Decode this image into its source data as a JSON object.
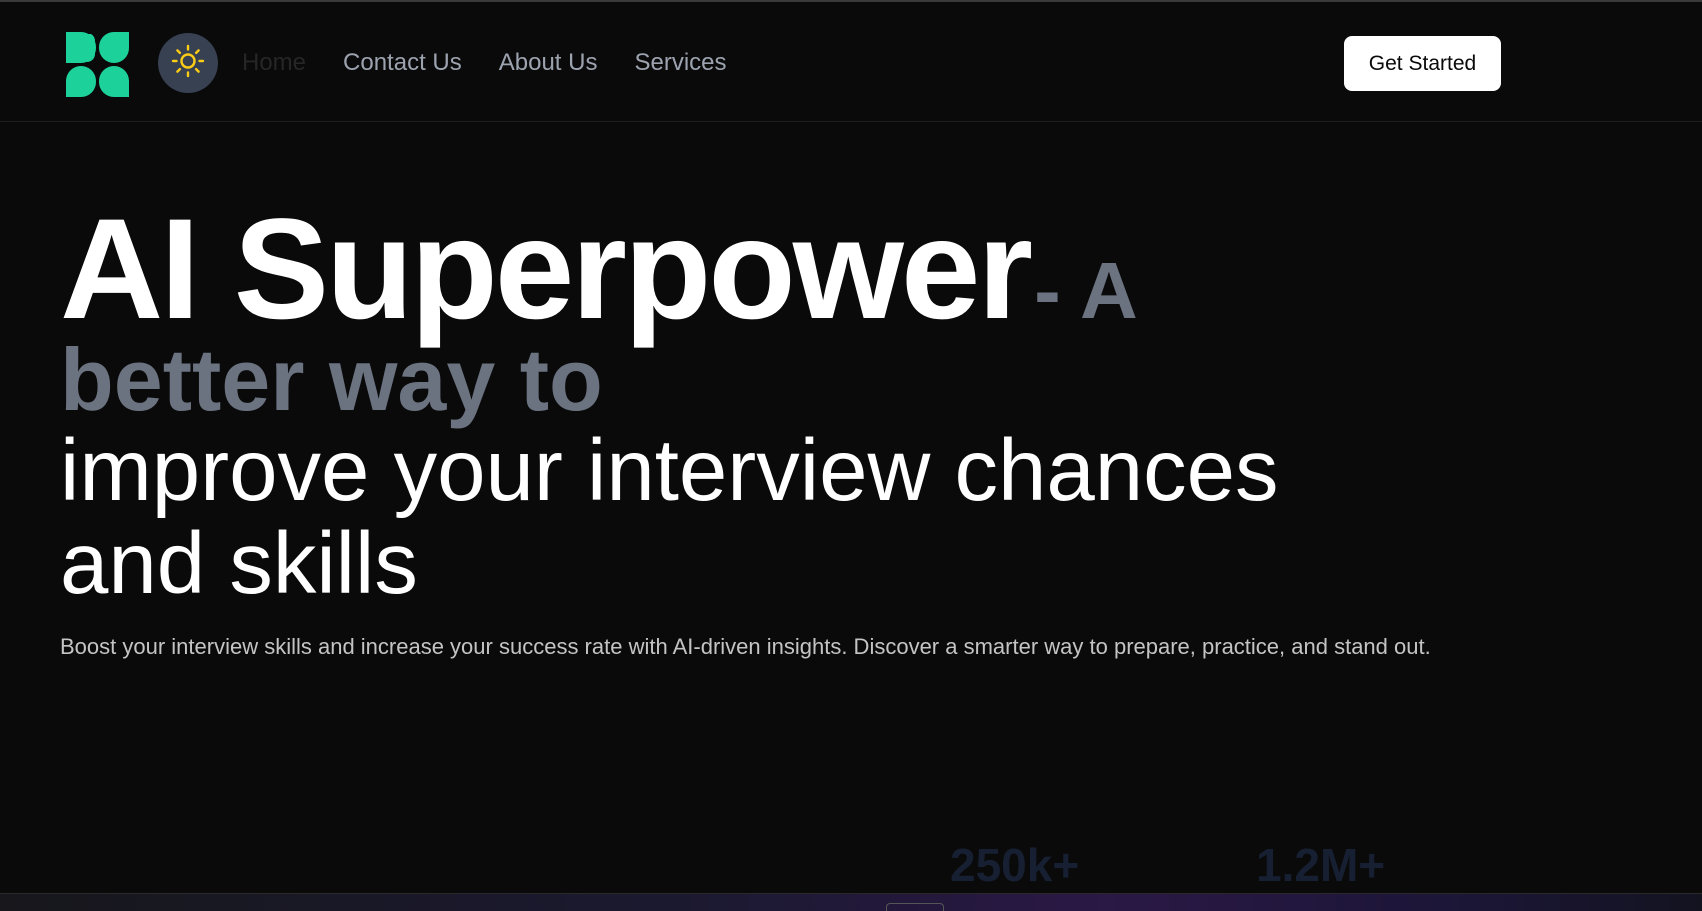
{
  "header": {
    "logo_icon": "clover-logo-icon",
    "logo_color": "#1dd19a",
    "theme_toggle_icon": "sun-icon",
    "theme_toggle_color": "#facc15",
    "nav": [
      {
        "label": "Home",
        "active": true
      },
      {
        "label": "Contact Us",
        "active": false
      },
      {
        "label": "About Us",
        "active": false
      },
      {
        "label": "Services",
        "active": false
      }
    ],
    "cta_label": "Get Started"
  },
  "hero": {
    "headline_bold": "AI Superpower",
    "headline_accent_1": "- A",
    "headline_accent_2": "better way to",
    "headline_line3": "improve your interview chances",
    "headline_line4": "and skills",
    "subtitle": "Boost your interview skills and increase your success rate with AI-driven insights. Discover a smarter way to prepare, practice, and stand out."
  },
  "stats": [
    {
      "value": "250k+"
    },
    {
      "value": "1.2M+"
    }
  ],
  "colors": {
    "background": "#0a0a0a",
    "accent_gray": "#6b7280",
    "brand_green": "#1dd19a",
    "stat_color": "#172033"
  }
}
